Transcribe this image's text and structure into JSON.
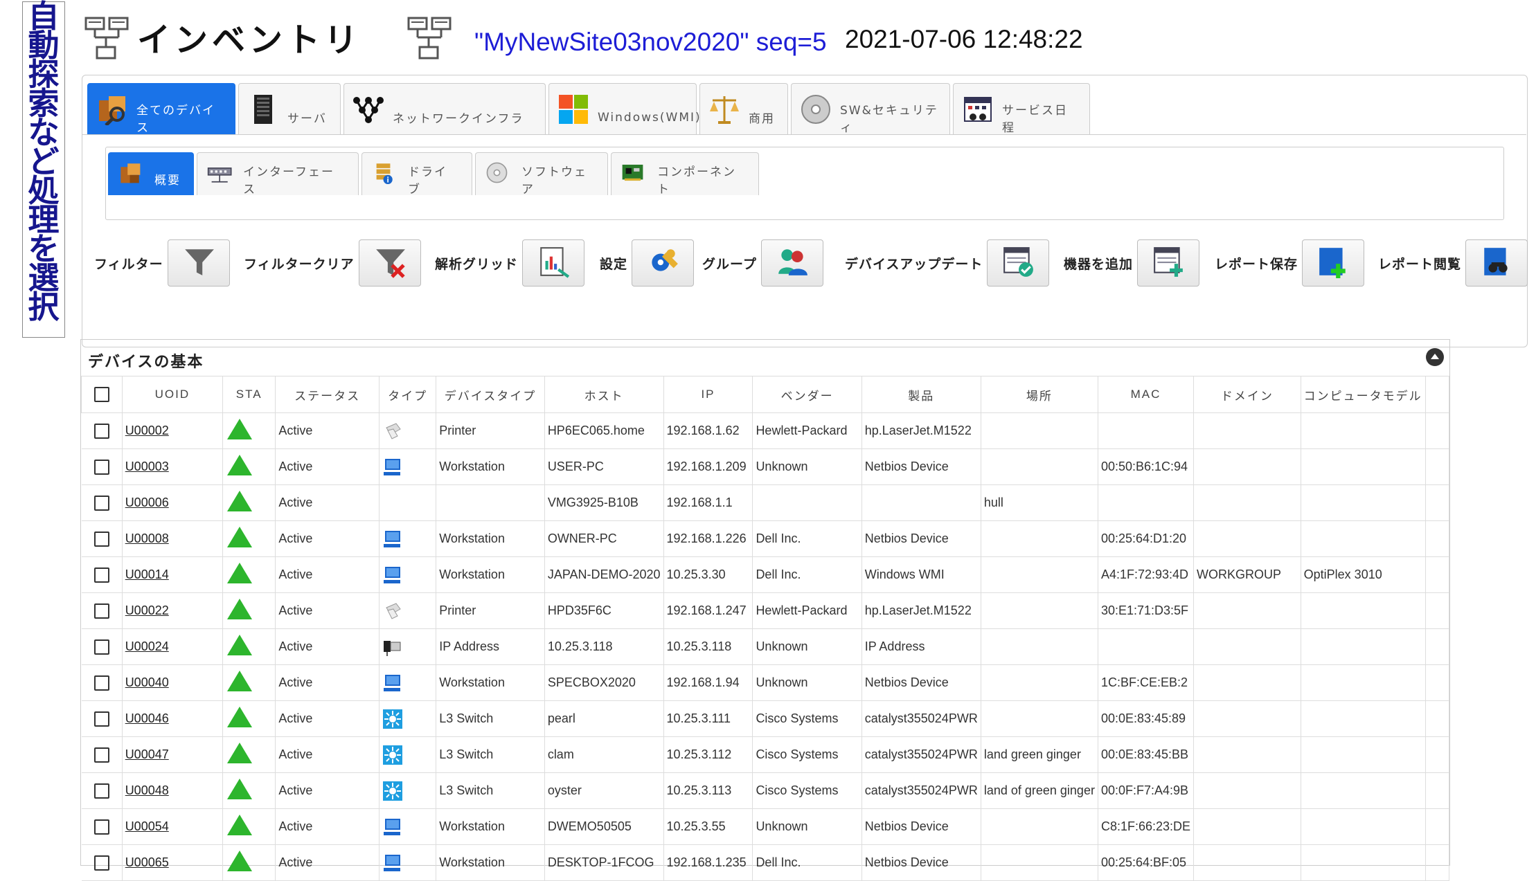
{
  "banner": {
    "chars": [
      "自",
      "動",
      "探",
      "索",
      "な",
      "ど",
      "処",
      "理",
      "を",
      "選",
      "択"
    ]
  },
  "header": {
    "title": "インベントリ",
    "site": "\"MyNewSite03nov2020\" seq=5",
    "timestamp": "2021-07-06 12:48:22"
  },
  "main_tabs": [
    {
      "label": "全てのデバイス",
      "icon": "all-devices-icon",
      "active": true
    },
    {
      "label": "サーバ",
      "icon": "server-icon"
    },
    {
      "label": "ネットワークインフラ",
      "icon": "network-icon"
    },
    {
      "label": "Windows(WMI)",
      "icon": "windows-icon"
    },
    {
      "label": "商用",
      "icon": "scale-icon"
    },
    {
      "label": "SW&セキュリティ",
      "icon": "disc-icon"
    },
    {
      "label": "サービス日程",
      "icon": "calendar-icon"
    }
  ],
  "sub_tabs": [
    {
      "label": "概要",
      "icon": "overview-icon",
      "active": true
    },
    {
      "label": "インターフェース",
      "icon": "interface-icon"
    },
    {
      "label": "ドライブ",
      "icon": "drive-icon"
    },
    {
      "label": "ソフトウェア",
      "icon": "software-icon"
    },
    {
      "label": "コンポーネント",
      "icon": "component-icon"
    }
  ],
  "toolbar": [
    {
      "label": "フィルター",
      "icon": "filter-icon"
    },
    {
      "label": "フィルタークリア",
      "icon": "filter-clear-icon"
    },
    {
      "label": "解析グリッド",
      "icon": "analysis-grid-icon"
    },
    {
      "label": "設定",
      "icon": "settings-icon"
    },
    {
      "label": "グループ",
      "icon": "group-icon"
    },
    {
      "label": "デバイスアップデート",
      "icon": "device-update-icon"
    },
    {
      "label": "機器を追加",
      "icon": "add-device-icon"
    },
    {
      "label": "レポート保存",
      "icon": "save-report-icon"
    },
    {
      "label": "レポート閲覧",
      "icon": "view-report-icon"
    }
  ],
  "section": {
    "title": "デバイスの基本"
  },
  "columns": [
    "UOID",
    "STA",
    "ステータス",
    "タイプ",
    "デバイスタイプ",
    "ホスト",
    "IP",
    "ベンダー",
    "製品",
    "場所",
    "MAC",
    "ドメイン",
    "コンピュータモデル"
  ],
  "colors": {
    "accent": "#1a73e8",
    "status_active": "#2db52d",
    "site_text": "#1d1dd6",
    "banner_text": "#16168e"
  },
  "rows": [
    {
      "uoid": "U00002",
      "status": "Active",
      "type_icon": "printer-icon",
      "device_type": "Printer",
      "host": "HP6EC065.home",
      "ip": "192.168.1.62",
      "vendor": "Hewlett-Packard",
      "product": "hp.LaserJet.M1522",
      "location": "",
      "mac": "",
      "domain": "",
      "model": ""
    },
    {
      "uoid": "U00003",
      "status": "Active",
      "type_icon": "workstation-icon",
      "device_type": "Workstation",
      "host": "USER-PC",
      "ip": "192.168.1.209",
      "vendor": "Unknown",
      "product": "Netbios Device",
      "location": "",
      "mac": "00:50:B6:1C:94",
      "domain": "",
      "model": ""
    },
    {
      "uoid": "U00006",
      "status": "Active",
      "type_icon": "",
      "device_type": "",
      "host": "VMG3925-B10B",
      "ip": "192.168.1.1",
      "vendor": "",
      "product": "",
      "location": "hull",
      "mac": "",
      "domain": "",
      "model": ""
    },
    {
      "uoid": "U00008",
      "status": "Active",
      "type_icon": "workstation-icon",
      "device_type": "Workstation",
      "host": "OWNER-PC",
      "ip": "192.168.1.226",
      "vendor": "Dell Inc.",
      "product": "Netbios Device",
      "location": "",
      "mac": "00:25:64:D1:20",
      "domain": "",
      "model": ""
    },
    {
      "uoid": "U00014",
      "status": "Active",
      "type_icon": "workstation-icon",
      "device_type": "Workstation",
      "host": "JAPAN-DEMO-2020",
      "ip": "10.25.3.30",
      "vendor": "Dell Inc.",
      "product": "Windows WMI",
      "location": "",
      "mac": "A4:1F:72:93:4D",
      "domain": "WORKGROUP",
      "model": "OptiPlex 3010"
    },
    {
      "uoid": "U00022",
      "status": "Active",
      "type_icon": "printer-icon",
      "device_type": "Printer",
      "host": "HPD35F6C",
      "ip": "192.168.1.247",
      "vendor": "Hewlett-Packard",
      "product": "hp.LaserJet.M1522",
      "location": "",
      "mac": "30:E1:71:D3:5F",
      "domain": "",
      "model": ""
    },
    {
      "uoid": "U00024",
      "status": "Active",
      "type_icon": "ip-address-icon",
      "device_type": "IP Address",
      "host": "10.25.3.118",
      "ip": "10.25.3.118",
      "vendor": "Unknown",
      "product": "IP Address",
      "location": "",
      "mac": "",
      "domain": "",
      "model": ""
    },
    {
      "uoid": "U00040",
      "status": "Active",
      "type_icon": "workstation-icon",
      "device_type": "Workstation",
      "host": "SPECBOX2020",
      "ip": "192.168.1.94",
      "vendor": "Unknown",
      "product": "Netbios Device",
      "location": "",
      "mac": "1C:BF:CE:EB:2",
      "domain": "",
      "model": ""
    },
    {
      "uoid": "U00046",
      "status": "Active",
      "type_icon": "l3-switch-icon",
      "device_type": "L3 Switch",
      "host": "pearl",
      "ip": "10.25.3.111",
      "vendor": "Cisco Systems",
      "product": "catalyst355024PWR",
      "location": "",
      "mac": "00:0E:83:45:89",
      "domain": "",
      "model": ""
    },
    {
      "uoid": "U00047",
      "status": "Active",
      "type_icon": "l3-switch-icon",
      "device_type": "L3 Switch",
      "host": "clam",
      "ip": "10.25.3.112",
      "vendor": "Cisco Systems",
      "product": "catalyst355024PWR",
      "location": "land green ginger",
      "mac": "00:0E:83:45:BB",
      "domain": "",
      "model": ""
    },
    {
      "uoid": "U00048",
      "status": "Active",
      "type_icon": "l3-switch-icon",
      "device_type": "L3 Switch",
      "host": "oyster",
      "ip": "10.25.3.113",
      "vendor": "Cisco Systems",
      "product": "catalyst355024PWR",
      "location": "land of green ginger",
      "mac": "00:0F:F7:A4:9B",
      "domain": "",
      "model": ""
    },
    {
      "uoid": "U00054",
      "status": "Active",
      "type_icon": "workstation-icon",
      "device_type": "Workstation",
      "host": "DWEMO50505",
      "ip": "10.25.3.55",
      "vendor": "Unknown",
      "product": "Netbios Device",
      "location": "",
      "mac": "C8:1F:66:23:DE",
      "domain": "",
      "model": ""
    },
    {
      "uoid": "U00065",
      "status": "Active",
      "type_icon": "workstation-icon",
      "device_type": "Workstation",
      "host": "DESKTOP-1FCOG",
      "ip": "192.168.1.235",
      "vendor": "Dell Inc.",
      "product": "Netbios Device",
      "location": "",
      "mac": "00:25:64:BF:05",
      "domain": "",
      "model": ""
    }
  ]
}
